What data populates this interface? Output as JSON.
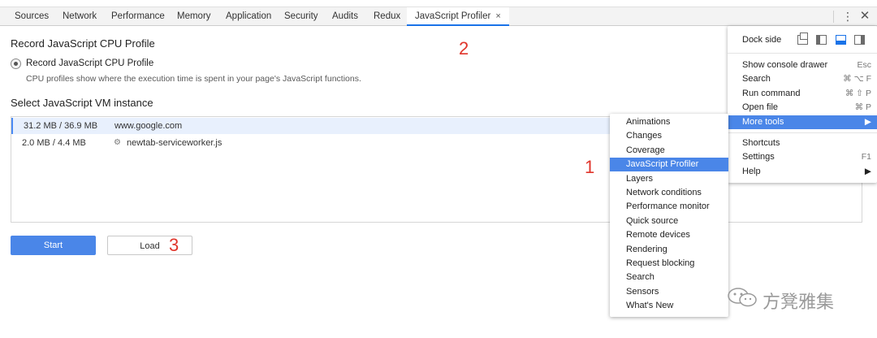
{
  "tabs": [
    {
      "label": "Sources"
    },
    {
      "label": "Network"
    },
    {
      "label": "Performance"
    },
    {
      "label": "Memory"
    },
    {
      "label": "Application"
    },
    {
      "label": "Security"
    },
    {
      "label": "Audits"
    },
    {
      "label": "Redux"
    },
    {
      "label": "JavaScript Profiler",
      "active": true,
      "close": "×"
    }
  ],
  "toolbar": {
    "kebab": "⋮",
    "close": "✕"
  },
  "main": {
    "section1_title": "Record JavaScript CPU Profile",
    "radio_label": "Record JavaScript CPU Profile",
    "description": "CPU profiles show where the execution time is spent in your page's JavaScript functions.",
    "section2_title": "Select JavaScript VM instance",
    "vm_instances": [
      {
        "memory": "31.2 MB / 36.9 MB",
        "target": "www.google.com",
        "selected": true
      },
      {
        "memory": "2.0 MB / 4.4 MB",
        "target": "newtab-serviceworker.js",
        "icon": "gear-icon"
      }
    ],
    "start_label": "Start",
    "load_label": "Load"
  },
  "annotations": {
    "one": "1",
    "two": "2",
    "three": "3"
  },
  "main_menu": {
    "dock_side_label": "Dock side",
    "dock_options": [
      "undock-icon",
      "dock-left-icon",
      "dock-bottom-icon",
      "dock-right-icon"
    ],
    "items": [
      {
        "label": "Show console drawer",
        "shortcut": "Esc"
      },
      {
        "label": "Search",
        "shortcut": "⌘ ⌥ F"
      },
      {
        "label": "Run command",
        "shortcut": "⌘ ⇧ P"
      },
      {
        "label": "Open file",
        "shortcut": "⌘ P"
      },
      {
        "label": "More tools",
        "shortcut": "▶",
        "highlighted": true
      },
      {
        "label": "Shortcuts",
        "shortcut": ""
      },
      {
        "label": "Settings",
        "shortcut": "F1"
      },
      {
        "label": "Help",
        "shortcut": "▶"
      }
    ]
  },
  "more_tools_menu": {
    "items": [
      {
        "label": "Animations"
      },
      {
        "label": "Changes"
      },
      {
        "label": "Coverage"
      },
      {
        "label": "JavaScript Profiler",
        "highlighted": true
      },
      {
        "label": "Layers"
      },
      {
        "label": "Network conditions"
      },
      {
        "label": "Performance monitor"
      },
      {
        "label": "Quick source"
      },
      {
        "label": "Remote devices"
      },
      {
        "label": "Rendering"
      },
      {
        "label": "Request blocking"
      },
      {
        "label": "Search"
      },
      {
        "label": "Sensors"
      },
      {
        "label": "What's New"
      }
    ]
  },
  "watermark": {
    "text": "方凳雅集",
    "icon": "wechat-icon"
  },
  "colors": {
    "accent": "#4a86e8",
    "annotation": "#e0352b",
    "tab_active_underline": "#1a73e8"
  }
}
